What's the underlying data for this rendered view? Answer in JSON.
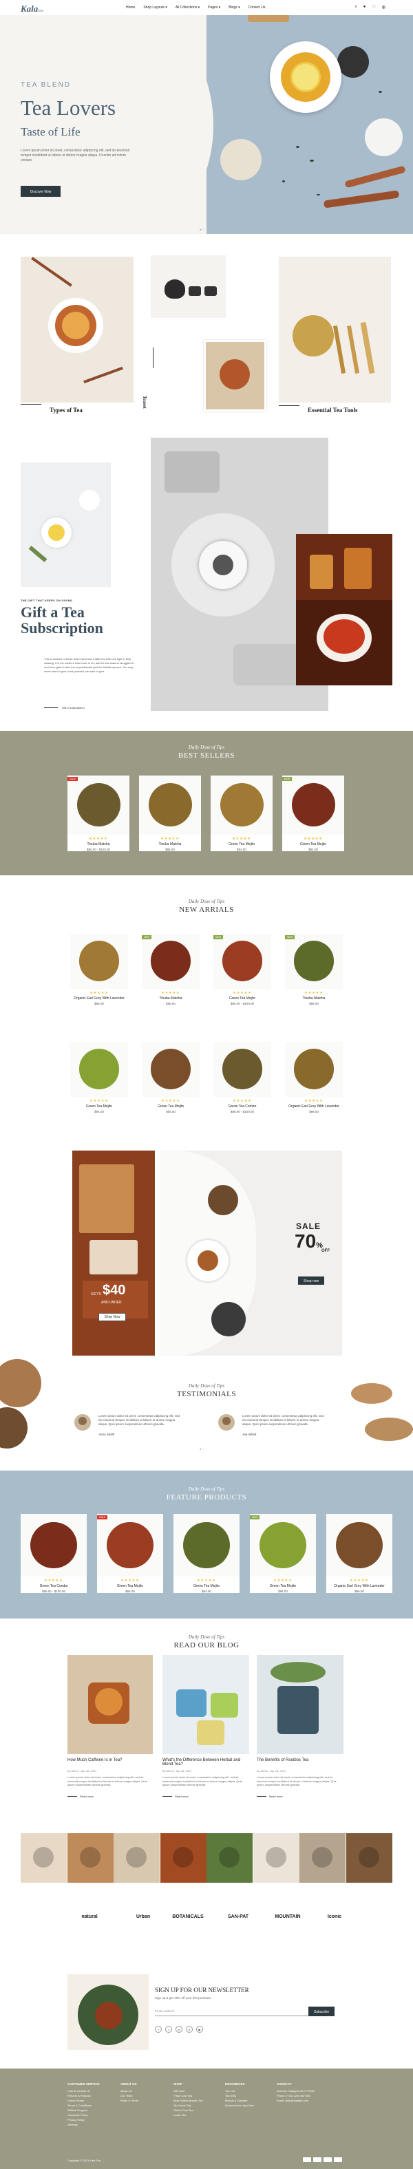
{
  "header": {
    "logo": "Kala",
    "logo_suffix": "tea",
    "nav": [
      "Home",
      "Shop Layouts ▾",
      "All Collections ▾",
      "Pages ▾",
      "Blogs ▾",
      "Contact Us"
    ]
  },
  "hero": {
    "kicker": "TEA BLEND",
    "title": "Tea Lovers",
    "subtitle": "Taste of Life",
    "description": "Lorem ipsum dolor sit amet, consectetur adipiscing elit, sed do eiusmod tempor incididunt ut labore et dolore magna aliqua. Ut enim ad minim veniam.",
    "button": "Discover Now"
  },
  "categories": {
    "types": "Types of Tea",
    "teaset": "Teaset",
    "tools": "Essential Tea Tools"
  },
  "gift": {
    "kicker": "THE GIFT THAT KEEPS ON GIVING",
    "title_line1": "Gift a Tea",
    "title_line2": "Subscription",
    "description": "This is another of those lovers who had a little tent with one light in their clearing. For the soldiers who knew in the tale the tea-makers struggled in and were glad to take the unpredictable part the hillside spaces. You may never want to give a tea yourself, we want to give.",
    "button": "Gift a Subscription"
  },
  "best_sellers": {
    "kicker": "Daily Dose of Tips",
    "title": "BEST SELLERS",
    "items": [
      {
        "tag": "SALE",
        "name": "Tinuba Matcha",
        "price": "$80.00 - $100.00"
      },
      {
        "tag": "",
        "name": "Tinuba Matcha",
        "price": "$86.00"
      },
      {
        "tag": "",
        "name": "Green Tea Mojito",
        "price": "$94.00"
      },
      {
        "tag": "NEW",
        "name": "Green Tea Mojito",
        "price": "$94.00"
      }
    ]
  },
  "new_arrivals": {
    "kicker": "Daily Dose of Tips",
    "title": "NEW ARRIALS",
    "items": [
      {
        "tag": "",
        "name": "Organic Earl Grey With Lavender",
        "price": "$96.00"
      },
      {
        "tag": "NEW",
        "name": "Tinuba Matcha",
        "price": "$86.00"
      },
      {
        "tag": "NEW",
        "name": "Green Tea Mojito",
        "price": "$80.00 - $100.00"
      },
      {
        "tag": "NEW",
        "name": "Tinuba Matcha",
        "price": "$86.00"
      },
      {
        "tag": "",
        "name": "Green Tea Mojito",
        "price": "$94.00"
      },
      {
        "tag": "",
        "name": "Green Tea Mojito",
        "price": "$94.00"
      },
      {
        "tag": "",
        "name": "Green Tea Combo",
        "price": "$86.00 - $100.00"
      },
      {
        "tag": "",
        "name": "Organic Earl Grey With Lavender",
        "price": "$96.00"
      }
    ]
  },
  "promo": {
    "left_prefix": "GIFTS",
    "left_price": "$40",
    "left_suffix": "AND UNDER",
    "left_button": "Shop Now",
    "sale_word": "SALE",
    "sale_pct": "70",
    "sale_pct_unit": "%",
    "sale_off": "OFF",
    "sale_button": "Shop now"
  },
  "testimonials": {
    "kicker": "Daily Dose of Tips",
    "title": "TESTIMONIALS",
    "items": [
      {
        "text": "Lorem ipsum dolor sit amet, consectetur adipiscing elit, sed do eiusmod tempor incididunt ut labore et dolore magna aliqua. Quis ipsum suspendisse ultrices gravida.",
        "name": "Anna Smith"
      },
      {
        "text": "Lorem ipsum dolor sit amet, consectetur adipiscing elit, sed do eiusmod tempor incididunt ut labore et dolore magna aliqua. Quis ipsum suspendisse ultrices gravida.",
        "name": "Joe Alfred"
      }
    ]
  },
  "featured": {
    "kicker": "Daily Dose of Tips",
    "title": "FEATURE PRODUCTS",
    "items": [
      {
        "tag": "",
        "name": "Green Tea Combo",
        "price": "$86.00 - $100.00"
      },
      {
        "tag": "SALE",
        "name": "Green Tea Mojito",
        "price": "$94.00"
      },
      {
        "tag": "",
        "name": "Green Tea Mojito",
        "price": "$94.00"
      },
      {
        "tag": "NEW",
        "name": "Green Tea Mojito",
        "price": "$94.00"
      },
      {
        "tag": "",
        "name": "Organic Earl Grey With Lavender",
        "price": "$96.00"
      }
    ]
  },
  "blog": {
    "kicker": "Daily Dose of Tips",
    "title": "READ OUR BLOG",
    "read_more": "Read more",
    "posts": [
      {
        "title": "How Much Caffeine Is in Tea?",
        "meta": "By Alfred · Apr 28, 2021",
        "excerpt": "Lorem ipsum dolor sit amet, consectetur adipiscing elit, sed do eiusmod tempor incididunt ut labore et dolore magna aliqua. Quis ipsum suspendisse ultrices gravida."
      },
      {
        "title": "What's the Difference Between Herbal and Blend Tea?",
        "meta": "By Alfred · Apr 28, 2021",
        "excerpt": "Lorem ipsum dolor sit amet, consectetur adipiscing elit, sed do eiusmod tempor incididunt ut labore et dolore magna aliqua. Quis ipsum suspendisse ultrices gravida."
      },
      {
        "title": "The Benefits of Rooibos Tea",
        "meta": "By Alfred · Apr 28, 2021",
        "excerpt": "Lorem ipsum dolor sit amet, consectetur adipiscing elit, sed do eiusmod tempor incididunt ut labore et dolore magna aliqua. Quis ipsum suspendisse ultrices gravida."
      }
    ]
  },
  "brands": [
    "natural",
    "Urban",
    "BOTANICALS",
    "SAN-PAT",
    "MOUNTAIN",
    "Iconic"
  ],
  "newsletter": {
    "title": "SIGN UP FOR OUR NEWSLETTER",
    "subtitle": "Sign up & get 10% off your first purchase",
    "placeholder": "Email address",
    "button": "Subscribe"
  },
  "footer": {
    "cols": [
      {
        "title": "CUSTOMER SERVICE",
        "links": [
          "Help & Contact Us",
          "Returns & Refunds",
          "Online Stores",
          "Terms & Conditions",
          "Affiliate Program",
          "Corporate Policy",
          "Privacy Policy",
          "Sitemap"
        ]
      },
      {
        "title": "ABOUT US",
        "links": [
          "About Us",
          "Our Team",
          "Rules & Terms"
        ]
      },
      {
        "title": "SHOP",
        "links": [
          "Gift Card",
          "Fresh Cold Tea",
          "Best Sellers Brands Tea",
          "Tea Vorce Tea",
          "Gluten Free Tea",
          "Loose Tea"
        ]
      },
      {
        "title": "RESOURCES",
        "links": [
          "Tea 101",
          "Tea Gifts",
          "Brands & Teaware",
          "Download our App Now"
        ]
      },
      {
        "title": "CONTACT",
        "links": [
          "Address: Glasgow 23 KH 9765",
          "Phone: (+44) 1234 567 890",
          "Email: hello@kalatea.com"
        ]
      }
    ],
    "copyright": "Copyright © 2021 Kala Tea."
  }
}
